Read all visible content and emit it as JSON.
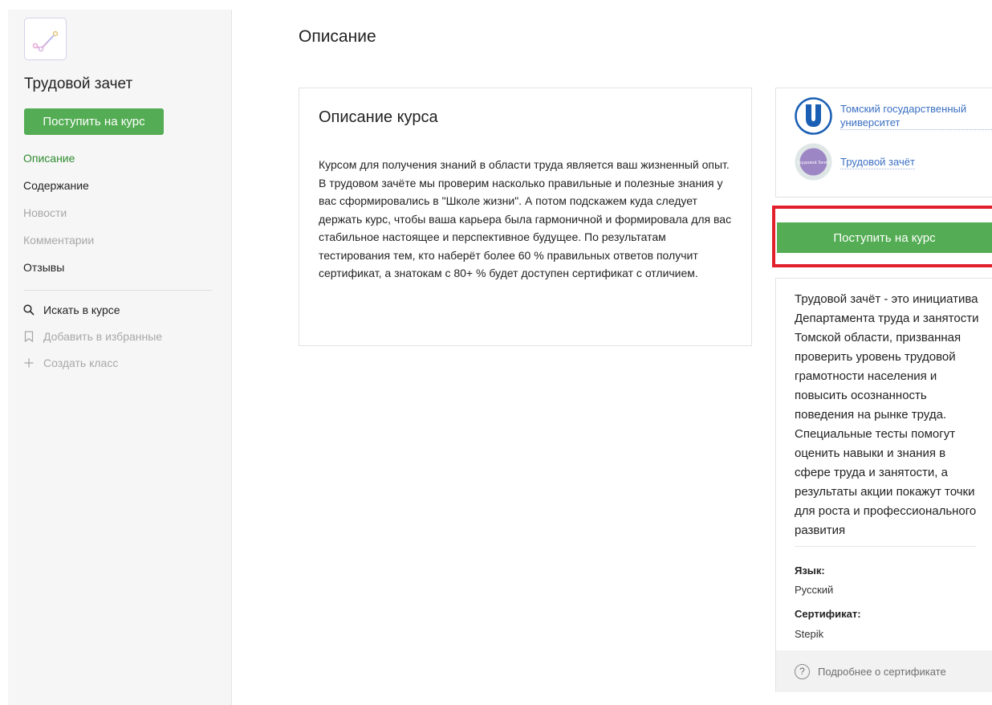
{
  "sidebar": {
    "course_title": "Трудовой зачет",
    "enroll_label": "Поступить на курс",
    "nav": [
      {
        "label": "Описание",
        "state": "active"
      },
      {
        "label": "Содержание",
        "state": "normal"
      },
      {
        "label": "Новости",
        "state": "muted"
      },
      {
        "label": "Комментарии",
        "state": "muted"
      },
      {
        "label": "Отзывы",
        "state": "normal"
      }
    ],
    "actions": [
      {
        "label": "Искать в курсе",
        "icon": "search-icon"
      },
      {
        "label": "Добавить в избранные",
        "icon": "bookmark-icon"
      },
      {
        "label": "Создать класс",
        "icon": "plus-icon"
      }
    ]
  },
  "main": {
    "page_title": "Описание",
    "card_title": "Описание курса",
    "card_text": "Курсом для получения знаний в области труда является ваш жизненный опыт. В трудовом зачёте мы проверим насколько правильные и полезные знания у вас сформировались в \"Школе жизни\". А потом подскажем куда следует держать курс, чтобы ваша карьера была гармоничной и формировала для вас стабильное настоящее и перспективное будущее. По результатам тестирования тем, кто наберёт более 60 % правильных ответов получит сертификат, а знатокам с 80+ % будет доступен сертификат с отличием."
  },
  "aside": {
    "orgs": [
      {
        "name": "Томский государственный университет",
        "logo": "tsu-logo"
      },
      {
        "name": "Трудовой зачёт",
        "logo": "trudovoy-zachet-logo",
        "logo_text": "Трудовой Зачёт"
      }
    ],
    "enroll_label": "Поступить на курс",
    "about": "Трудовой зачёт - это инициатива Департамента труда и занятости Томской области, призванная проверить уровень трудовой грамотности населения и повысить осознанность поведения на рынке труда. Специальные тесты помогут оценить навыки и знания в сфере труда и занятости, а результаты акции покажут точки для роста и профессионального развития",
    "language_label": "Язык:",
    "language_value": "Русский",
    "certificate_label": "Сертификат:",
    "certificate_value": "Stepik",
    "cert_more": "Подробнее о сертификате",
    "cert_more_icon": "question-icon"
  },
  "colors": {
    "accent_green": "#54ad54",
    "active_nav": "#2f8b2f",
    "link_blue": "#3b6fc2",
    "highlight_red": "#e2202c"
  }
}
